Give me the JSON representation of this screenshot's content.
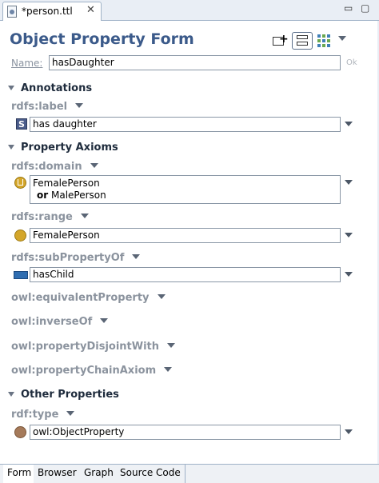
{
  "editor_tab": {
    "title": "*person.ttl",
    "close": "✕"
  },
  "window": {
    "minimize": "▭",
    "maximize": "▢"
  },
  "form": {
    "title": "Object Property Form",
    "name_label": "Name:",
    "name_value": "hasDaughter",
    "ok_label": "Ok"
  },
  "sections": {
    "annotations": "Annotations",
    "property_axioms": "Property Axioms",
    "other_properties": "Other Properties"
  },
  "rows": {
    "rdfs_label": {
      "label": "rdfs:label",
      "value": "has daughter",
      "icon": "string-literal-icon"
    },
    "rdfs_domain": {
      "label": "rdfs:domain",
      "value_line1": "FemalePerson",
      "or_keyword": "or",
      "value_line2": "MalePerson",
      "icon": "union-class-icon"
    },
    "rdfs_range": {
      "label": "rdfs:range",
      "value": "FemalePerson",
      "icon": "class-icon"
    },
    "rdfs_subPropertyOf": {
      "label": "rdfs:subPropertyOf",
      "value": "hasChild",
      "icon": "object-property-icon"
    },
    "owl_equivalentProperty": {
      "label": "owl:equivalentProperty"
    },
    "owl_inverseOf": {
      "label": "owl:inverseOf"
    },
    "owl_propertyDisjointWith": {
      "label": "owl:propertyDisjointWith"
    },
    "owl_propertyChainAxiom": {
      "label": "owl:propertyChainAxiom"
    },
    "rdf_type": {
      "label": "rdf:type",
      "value": "owl:ObjectProperty",
      "icon": "instance-icon"
    }
  },
  "bottom_tabs": [
    "Form",
    "Browser",
    "Graph",
    "Source Code"
  ],
  "colors": {
    "title_blue": "#3b5a8a",
    "class_icon": "#d4a62a",
    "instance_icon": "#a57a5a",
    "object_property_icon": "#2f6db0"
  }
}
